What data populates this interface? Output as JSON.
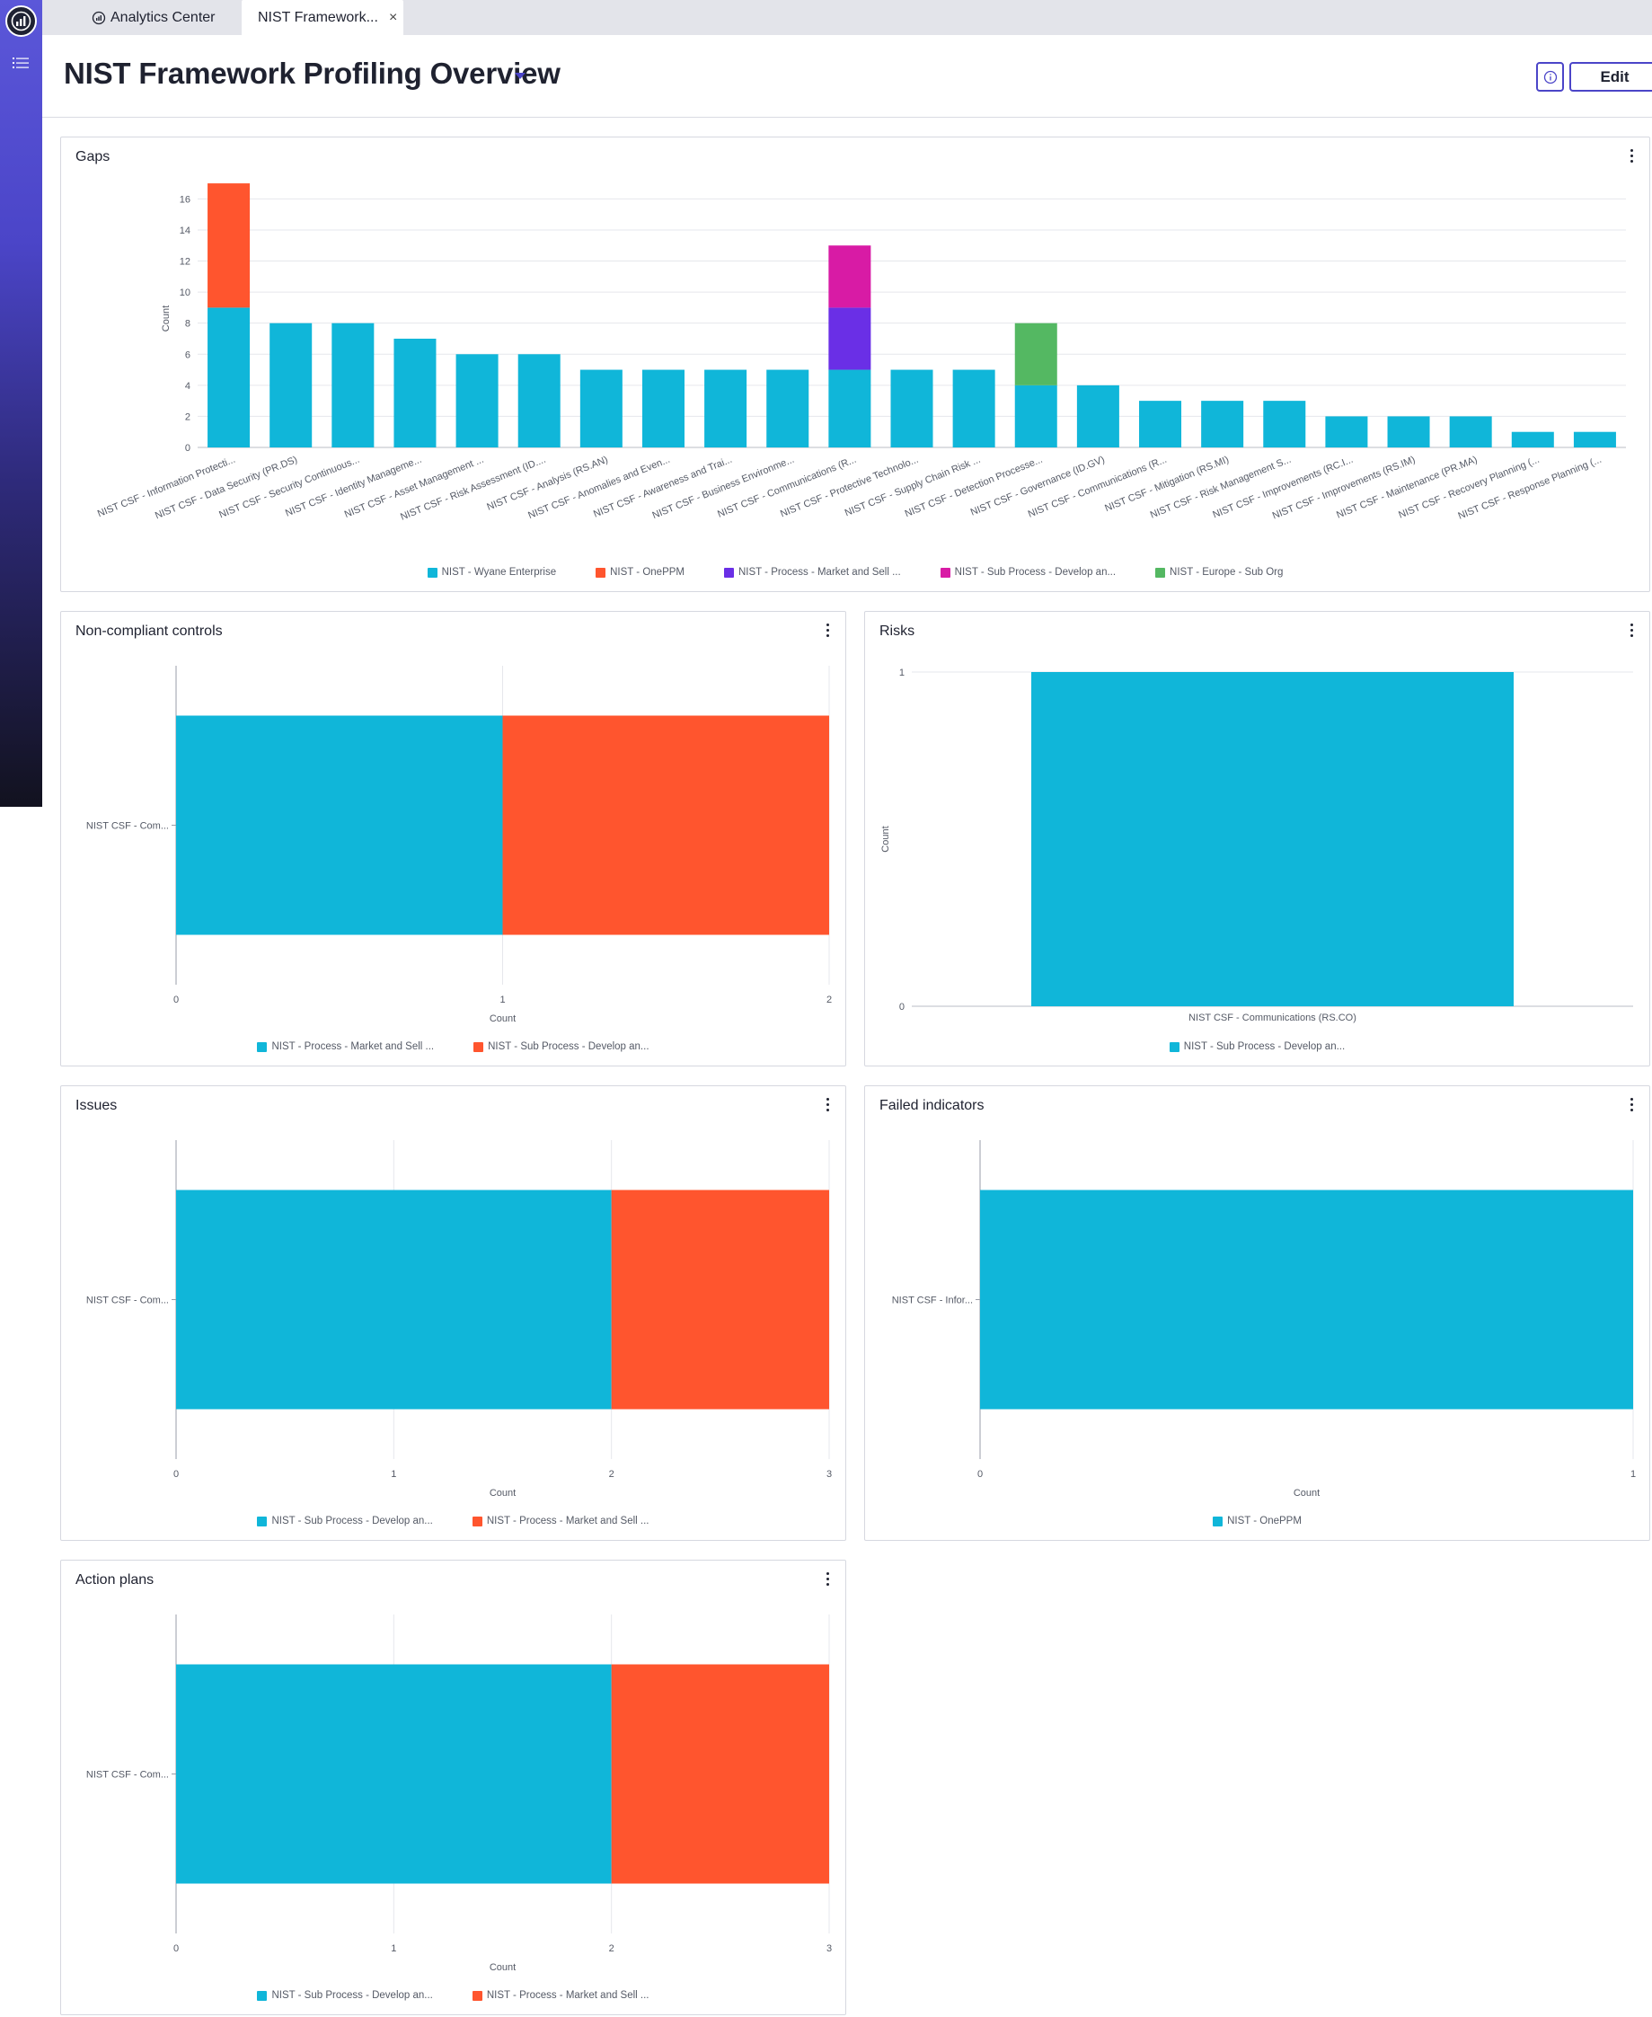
{
  "colors": {
    "wyane": "#10b6d9",
    "oneppm": "#ff552e",
    "process_market": "#6a2fe6",
    "sub_process": "#d81ba5",
    "europe": "#54b862"
  },
  "tabs": [
    {
      "label": "Analytics Center",
      "icon": "analytics-icon"
    },
    {
      "label": "NIST Framework...",
      "close": "×"
    }
  ],
  "header": {
    "title": "NIST Framework Profiling Overview",
    "edit_label": "Edit"
  },
  "panels": {
    "gaps": {
      "title": "Gaps"
    },
    "noncompliant": {
      "title": "Non-compliant controls"
    },
    "risks": {
      "title": "Risks"
    },
    "issues": {
      "title": "Issues"
    },
    "failed": {
      "title": "Failed indicators"
    },
    "actions": {
      "title": "Action plans"
    }
  },
  "chart_data": [
    {
      "id": "gaps",
      "type": "bar",
      "stacked": true,
      "title": "Gaps",
      "ylabel": "Count",
      "ylim": [
        0,
        16
      ],
      "yticks": [
        0,
        2,
        4,
        6,
        8,
        10,
        12,
        14,
        16
      ],
      "categories": [
        "NIST CSF - Information Protecti...",
        "NIST CSF - Data Security (PR.DS)",
        "NIST CSF - Security Continuous...",
        "NIST CSF - Identity Manageme...",
        "NIST CSF - Asset Management ...",
        "NIST CSF - Risk Assessment (ID....",
        "NIST CSF - Analysis (RS.AN)",
        "NIST CSF - Anomalies and Even...",
        "NIST CSF - Awareness and Trai...",
        "NIST CSF - Business Environme...",
        "NIST CSF - Communications (R...",
        "NIST CSF - Protective Technolo...",
        "NIST CSF - Supply Chain Risk ...",
        "NIST CSF - Detection Processe...",
        "NIST CSF - Governance (ID.GV)",
        "NIST CSF - Communications (R...",
        "NIST CSF - Mitigation (RS.MI)",
        "NIST CSF - Risk Management S...",
        "NIST CSF - Improvements (RC.I...",
        "NIST CSF - Improvements (RS.IM)",
        "NIST CSF - Maintenance (PR.MA)",
        "NIST CSF - Recovery Planning (...",
        "NIST CSF - Response Planning (..."
      ],
      "series": [
        {
          "name": "NIST - Wyane Enterprise",
          "color_key": "wyane",
          "values": [
            9,
            8,
            8,
            7,
            6,
            6,
            5,
            5,
            5,
            5,
            5,
            5,
            5,
            4,
            4,
            3,
            3,
            3,
            2,
            2,
            2,
            1,
            1
          ]
        },
        {
          "name": "NIST - OnePPM",
          "color_key": "oneppm",
          "values": [
            8,
            0,
            0,
            0,
            0,
            0,
            0,
            0,
            0,
            0,
            0,
            0,
            0,
            0,
            0,
            0,
            0,
            0,
            0,
            0,
            0,
            0,
            0
          ]
        },
        {
          "name": "NIST - Process - Market and Sell ...",
          "color_key": "process_market",
          "values": [
            0,
            0,
            0,
            0,
            0,
            0,
            0,
            0,
            0,
            0,
            4,
            0,
            0,
            0,
            0,
            0,
            0,
            0,
            0,
            0,
            0,
            0,
            0
          ]
        },
        {
          "name": "NIST - Sub Process - Develop an...",
          "color_key": "sub_process",
          "values": [
            0,
            0,
            0,
            0,
            0,
            0,
            0,
            0,
            0,
            0,
            4,
            0,
            0,
            0,
            0,
            0,
            0,
            0,
            0,
            0,
            0,
            0,
            0
          ]
        },
        {
          "name": "NIST - Europe - Sub Org",
          "color_key": "europe",
          "values": [
            0,
            0,
            0,
            0,
            0,
            0,
            0,
            0,
            0,
            0,
            0,
            0,
            0,
            4,
            0,
            0,
            0,
            0,
            0,
            0,
            0,
            0,
            0
          ]
        }
      ]
    },
    {
      "id": "noncompliant",
      "type": "bar",
      "orientation": "horizontal",
      "stacked": true,
      "title": "Non-compliant controls",
      "xlabel": "Count",
      "xlim": [
        0,
        2
      ],
      "xticks": [
        0,
        1,
        2
      ],
      "categories": [
        "NIST CSF - Com..."
      ],
      "series": [
        {
          "name": "NIST - Process - Market and Sell ...",
          "color_key": "wyane",
          "values": [
            1
          ]
        },
        {
          "name": "NIST - Sub Process - Develop an...",
          "color_key": "oneppm",
          "values": [
            1
          ]
        }
      ]
    },
    {
      "id": "risks",
      "type": "bar",
      "title": "Risks",
      "ylabel": "Count",
      "ylim": [
        0,
        1
      ],
      "yticks": [
        0,
        1
      ],
      "categories": [
        "NIST CSF - Communications (RS.CO)"
      ],
      "series": [
        {
          "name": "NIST - Sub Process - Develop an...",
          "color_key": "wyane",
          "values": [
            1
          ]
        }
      ]
    },
    {
      "id": "issues",
      "type": "bar",
      "orientation": "horizontal",
      "stacked": true,
      "title": "Issues",
      "xlabel": "Count",
      "xlim": [
        0,
        3
      ],
      "xticks": [
        0,
        1,
        2,
        3
      ],
      "categories": [
        "NIST CSF - Com..."
      ],
      "series": [
        {
          "name": "NIST - Sub Process - Develop an...",
          "color_key": "wyane",
          "values": [
            2
          ]
        },
        {
          "name": "NIST - Process - Market and Sell ...",
          "color_key": "oneppm",
          "values": [
            1
          ]
        }
      ]
    },
    {
      "id": "failed",
      "type": "bar",
      "orientation": "horizontal",
      "title": "Failed indicators",
      "xlabel": "Count",
      "xlim": [
        0,
        1
      ],
      "xticks": [
        0,
        1
      ],
      "categories": [
        "NIST CSF - Infor..."
      ],
      "series": [
        {
          "name": "NIST - OnePPM",
          "color_key": "wyane",
          "values": [
            1
          ]
        }
      ]
    },
    {
      "id": "actions",
      "type": "bar",
      "orientation": "horizontal",
      "stacked": true,
      "title": "Action plans",
      "xlabel": "Count",
      "xlim": [
        0,
        3
      ],
      "xticks": [
        0,
        1,
        2,
        3
      ],
      "categories": [
        "NIST CSF - Com..."
      ],
      "series": [
        {
          "name": "NIST - Sub Process - Develop an...",
          "color_key": "wyane",
          "values": [
            2
          ]
        },
        {
          "name": "NIST - Process - Market and Sell ...",
          "color_key": "oneppm",
          "values": [
            1
          ]
        }
      ]
    }
  ]
}
